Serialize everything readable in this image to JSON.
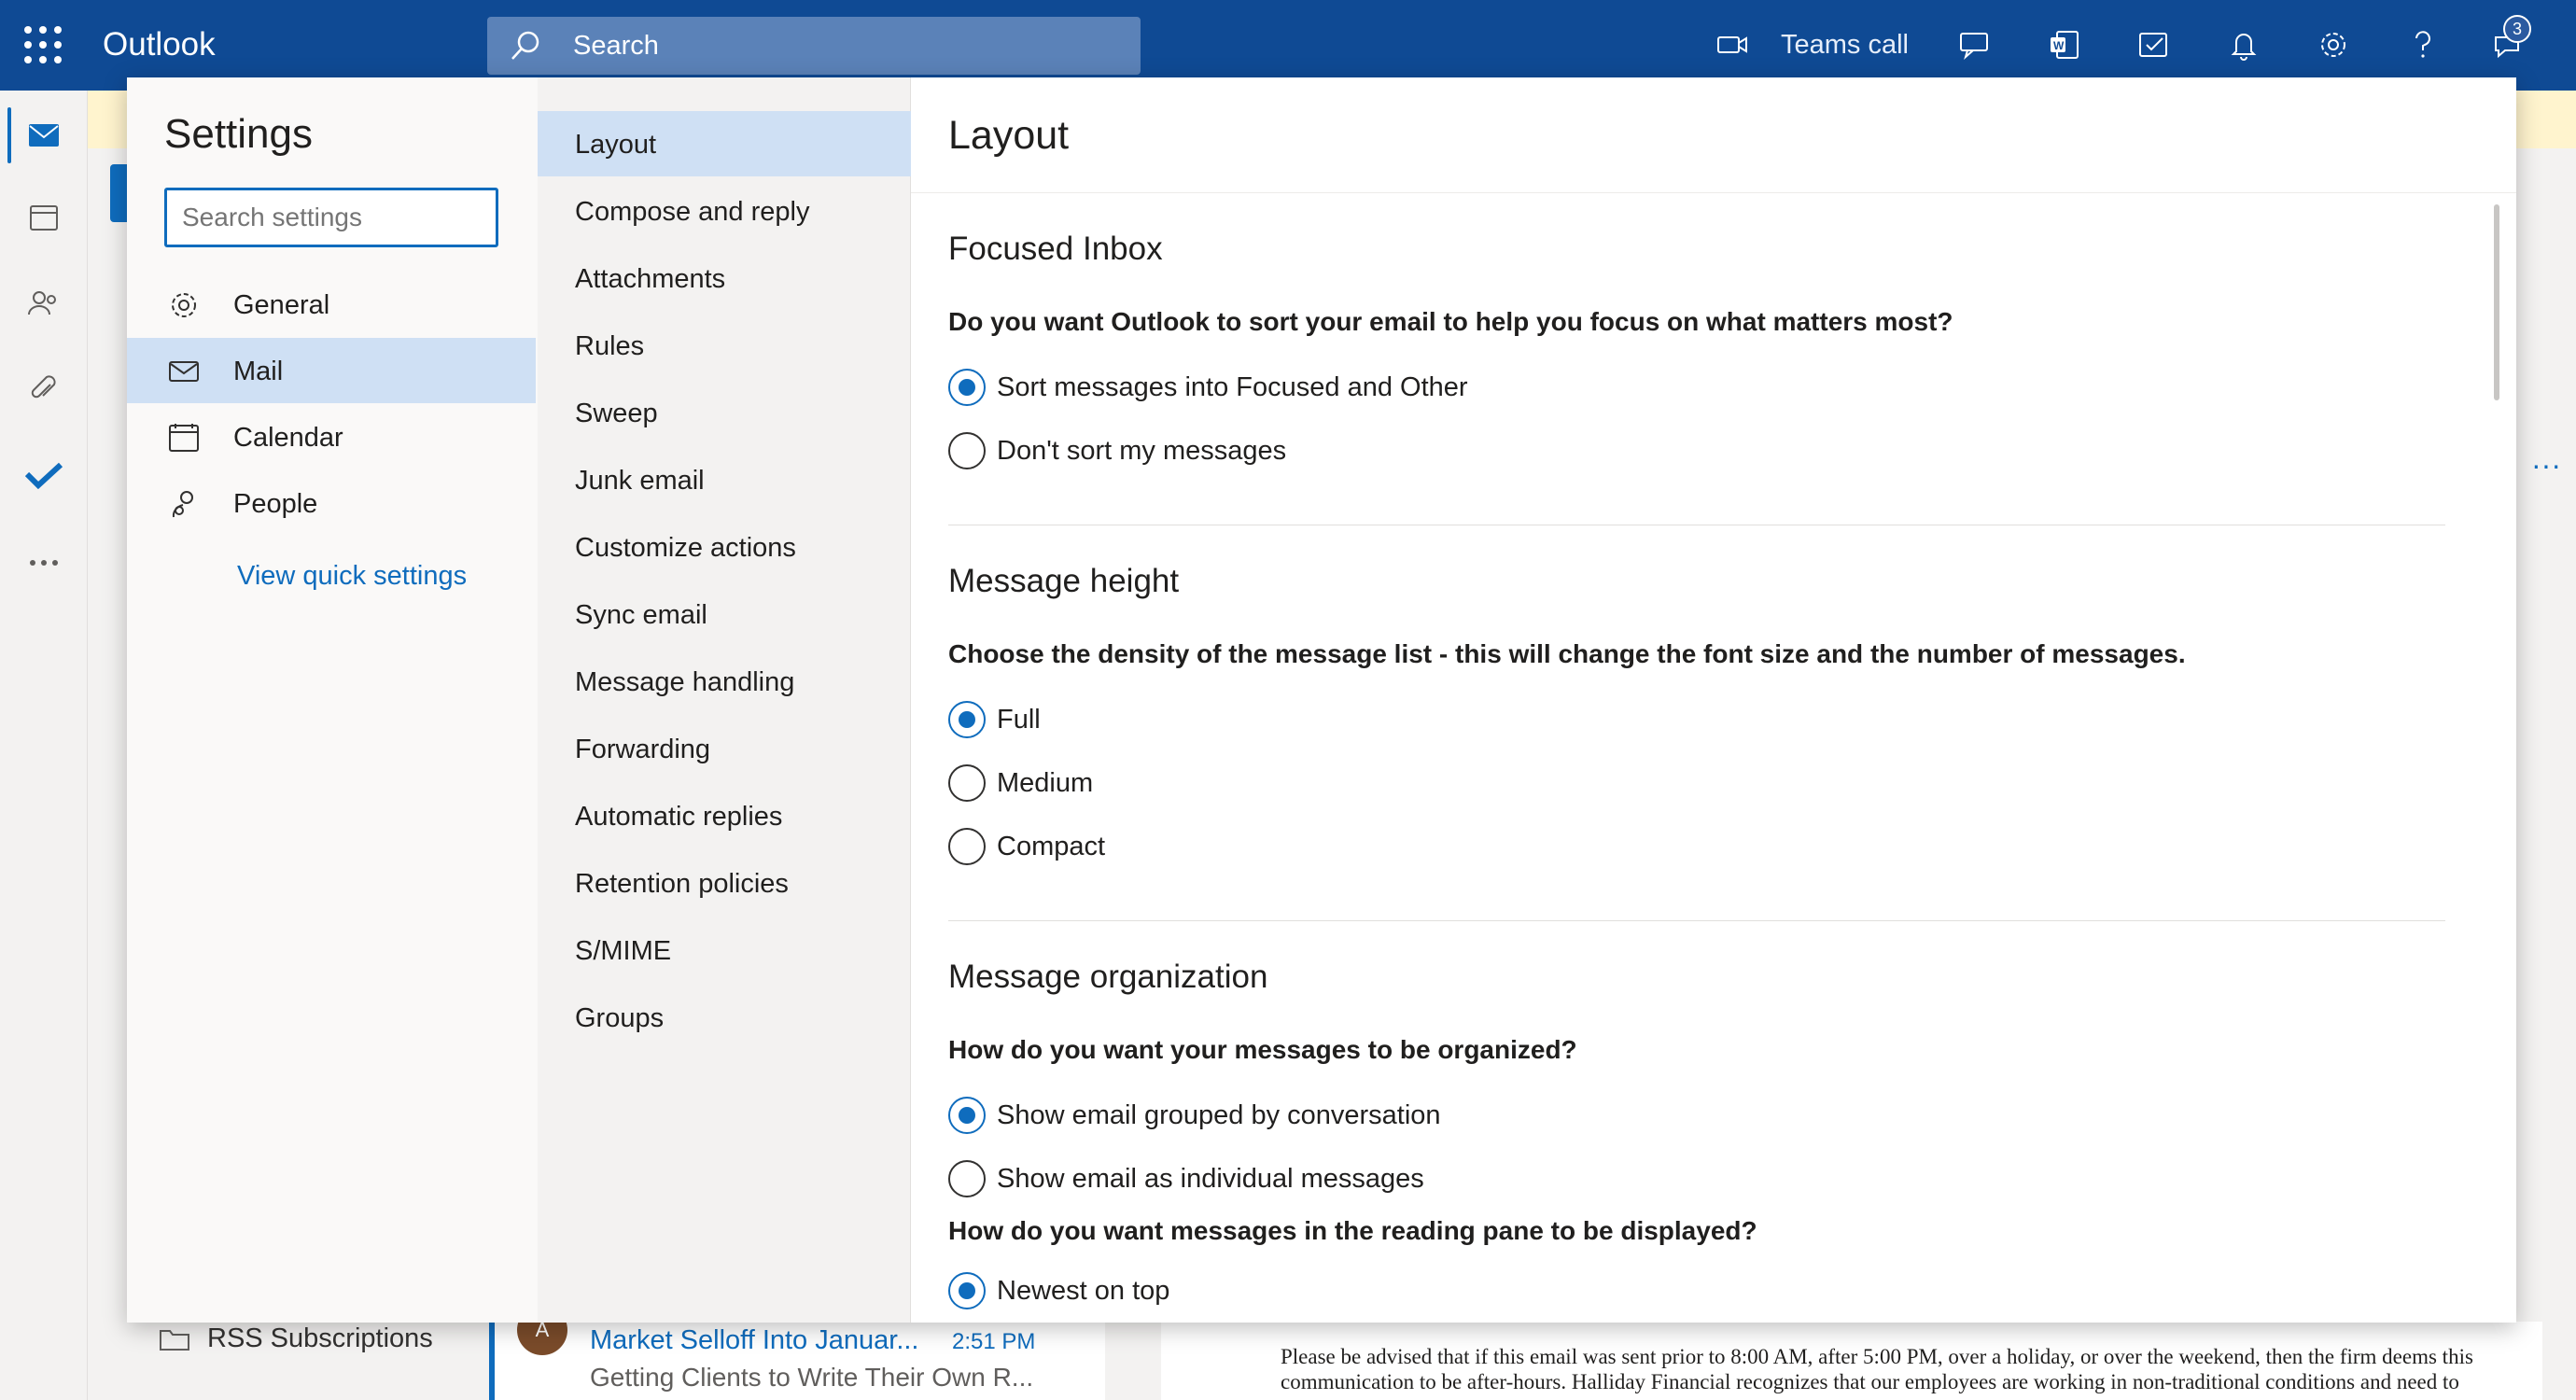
{
  "app": {
    "name": "Outlook"
  },
  "topbar": {
    "search_placeholder": "Search",
    "teams_call_label": "Teams call",
    "notification_count": "3",
    "icons": [
      "waffle-icon",
      "search-icon",
      "video-icon",
      "chat-icon",
      "word-icon",
      "tasks-icon",
      "bell-icon",
      "gear-icon",
      "help-icon",
      "feedback-icon"
    ]
  },
  "background": {
    "folder_label": "RSS Subscriptions",
    "message": {
      "subject": "Market Selloff Into Januar...",
      "time": "2:51 PM",
      "preview": "Getting Clients to Write Their Own R..."
    },
    "reading_text": "Please be advised that if this email was sent prior to 8:00 AM, after 5:00 PM, over a holiday, or over the weekend, then the firm deems this communication to be after-hours. Halliday Financial recognizes that our employees are working in non-traditional conditions and need to"
  },
  "settings": {
    "title": "Settings",
    "search_placeholder": "Search settings",
    "categories": [
      {
        "label": "General",
        "icon": "gear-icon",
        "selected": false
      },
      {
        "label": "Mail",
        "icon": "mail-icon",
        "selected": true
      },
      {
        "label": "Calendar",
        "icon": "calendar-icon",
        "selected": false
      },
      {
        "label": "People",
        "icon": "people-icon",
        "selected": false
      }
    ],
    "quick_settings_link": "View quick settings",
    "subcategories": [
      {
        "label": "Layout",
        "selected": true
      },
      {
        "label": "Compose and reply"
      },
      {
        "label": "Attachments"
      },
      {
        "label": "Rules"
      },
      {
        "label": "Sweep"
      },
      {
        "label": "Junk email"
      },
      {
        "label": "Customize actions"
      },
      {
        "label": "Sync email"
      },
      {
        "label": "Message handling"
      },
      {
        "label": "Forwarding"
      },
      {
        "label": "Automatic replies"
      },
      {
        "label": "Retention policies"
      },
      {
        "label": "S/MIME"
      },
      {
        "label": "Groups"
      }
    ]
  },
  "layout_pane": {
    "title": "Layout",
    "focused_inbox": {
      "heading": "Focused Inbox",
      "question": "Do you want Outlook to sort your email to help you focus on what matters most?",
      "options": [
        {
          "label": "Sort messages into Focused and Other",
          "selected": true
        },
        {
          "label": "Don't sort my messages",
          "selected": false
        }
      ]
    },
    "message_height": {
      "heading": "Message height",
      "question": "Choose the density of the message list - this will change the font size and the number of messages.",
      "options": [
        {
          "label": "Full",
          "selected": true
        },
        {
          "label": "Medium",
          "selected": false
        },
        {
          "label": "Compact",
          "selected": false
        }
      ]
    },
    "message_organization": {
      "heading": "Message organization",
      "question": "How do you want your messages to be organized?",
      "options": [
        {
          "label": "Show email grouped by conversation",
          "selected": true
        },
        {
          "label": "Show email as individual messages",
          "selected": false
        }
      ],
      "reading_question": "How do you want messages in the reading pane to be displayed?",
      "reading_options": [
        {
          "label": "Newest on top",
          "selected": true
        }
      ]
    }
  },
  "colors": {
    "brand_bar": "#0f4a94",
    "accent": "#0f6cbd",
    "selected_bg": "#cfe0f4"
  }
}
